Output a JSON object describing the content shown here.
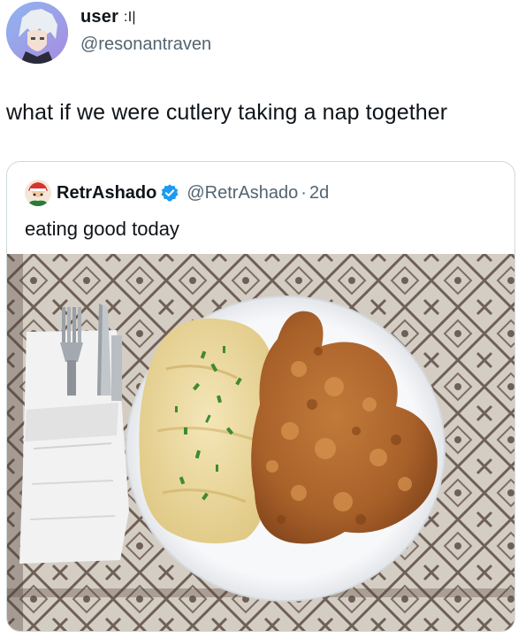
{
  "author": {
    "display_name": "user",
    "name_glyph": ":I|",
    "handle": "@resonantraven"
  },
  "tweet": {
    "text": "what if we were cutlery taking a nap together"
  },
  "quoted": {
    "display_name": "RetrAshado",
    "handle": "@RetrAshado",
    "separator": "·",
    "time": "2d",
    "text": "eating good today"
  },
  "colors": {
    "accent_verified": "#1d9bf0",
    "secondary_text": "#536471",
    "border": "#cfd9de"
  },
  "icons": {
    "verified": "verified-badge-icon"
  }
}
